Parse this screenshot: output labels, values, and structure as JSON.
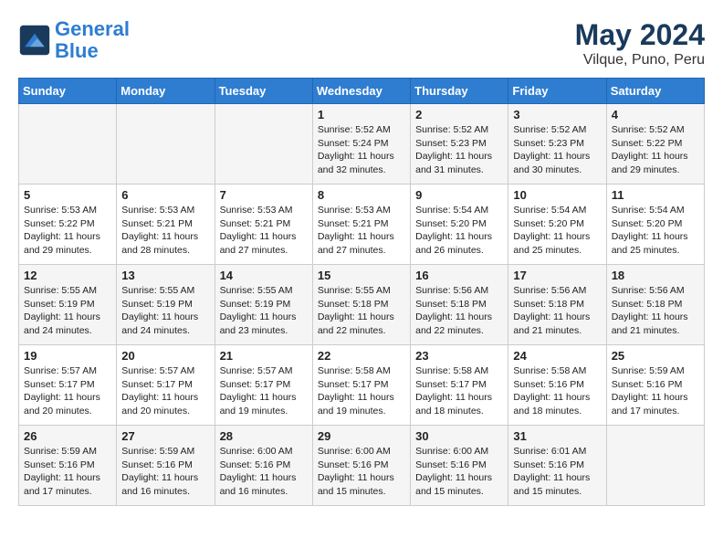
{
  "header": {
    "logo_line1": "General",
    "logo_line2": "Blue",
    "title": "May 2024",
    "subtitle": "Vilque, Puno, Peru"
  },
  "days_of_week": [
    "Sunday",
    "Monday",
    "Tuesday",
    "Wednesday",
    "Thursday",
    "Friday",
    "Saturday"
  ],
  "weeks": [
    [
      {
        "num": "",
        "info": ""
      },
      {
        "num": "",
        "info": ""
      },
      {
        "num": "",
        "info": ""
      },
      {
        "num": "1",
        "info": "Sunrise: 5:52 AM\nSunset: 5:24 PM\nDaylight: 11 hours\nand 32 minutes."
      },
      {
        "num": "2",
        "info": "Sunrise: 5:52 AM\nSunset: 5:23 PM\nDaylight: 11 hours\nand 31 minutes."
      },
      {
        "num": "3",
        "info": "Sunrise: 5:52 AM\nSunset: 5:23 PM\nDaylight: 11 hours\nand 30 minutes."
      },
      {
        "num": "4",
        "info": "Sunrise: 5:52 AM\nSunset: 5:22 PM\nDaylight: 11 hours\nand 29 minutes."
      }
    ],
    [
      {
        "num": "5",
        "info": "Sunrise: 5:53 AM\nSunset: 5:22 PM\nDaylight: 11 hours\nand 29 minutes."
      },
      {
        "num": "6",
        "info": "Sunrise: 5:53 AM\nSunset: 5:21 PM\nDaylight: 11 hours\nand 28 minutes."
      },
      {
        "num": "7",
        "info": "Sunrise: 5:53 AM\nSunset: 5:21 PM\nDaylight: 11 hours\nand 27 minutes."
      },
      {
        "num": "8",
        "info": "Sunrise: 5:53 AM\nSunset: 5:21 PM\nDaylight: 11 hours\nand 27 minutes."
      },
      {
        "num": "9",
        "info": "Sunrise: 5:54 AM\nSunset: 5:20 PM\nDaylight: 11 hours\nand 26 minutes."
      },
      {
        "num": "10",
        "info": "Sunrise: 5:54 AM\nSunset: 5:20 PM\nDaylight: 11 hours\nand 25 minutes."
      },
      {
        "num": "11",
        "info": "Sunrise: 5:54 AM\nSunset: 5:20 PM\nDaylight: 11 hours\nand 25 minutes."
      }
    ],
    [
      {
        "num": "12",
        "info": "Sunrise: 5:55 AM\nSunset: 5:19 PM\nDaylight: 11 hours\nand 24 minutes."
      },
      {
        "num": "13",
        "info": "Sunrise: 5:55 AM\nSunset: 5:19 PM\nDaylight: 11 hours\nand 24 minutes."
      },
      {
        "num": "14",
        "info": "Sunrise: 5:55 AM\nSunset: 5:19 PM\nDaylight: 11 hours\nand 23 minutes."
      },
      {
        "num": "15",
        "info": "Sunrise: 5:55 AM\nSunset: 5:18 PM\nDaylight: 11 hours\nand 22 minutes."
      },
      {
        "num": "16",
        "info": "Sunrise: 5:56 AM\nSunset: 5:18 PM\nDaylight: 11 hours\nand 22 minutes."
      },
      {
        "num": "17",
        "info": "Sunrise: 5:56 AM\nSunset: 5:18 PM\nDaylight: 11 hours\nand 21 minutes."
      },
      {
        "num": "18",
        "info": "Sunrise: 5:56 AM\nSunset: 5:18 PM\nDaylight: 11 hours\nand 21 minutes."
      }
    ],
    [
      {
        "num": "19",
        "info": "Sunrise: 5:57 AM\nSunset: 5:17 PM\nDaylight: 11 hours\nand 20 minutes."
      },
      {
        "num": "20",
        "info": "Sunrise: 5:57 AM\nSunset: 5:17 PM\nDaylight: 11 hours\nand 20 minutes."
      },
      {
        "num": "21",
        "info": "Sunrise: 5:57 AM\nSunset: 5:17 PM\nDaylight: 11 hours\nand 19 minutes."
      },
      {
        "num": "22",
        "info": "Sunrise: 5:58 AM\nSunset: 5:17 PM\nDaylight: 11 hours\nand 19 minutes."
      },
      {
        "num": "23",
        "info": "Sunrise: 5:58 AM\nSunset: 5:17 PM\nDaylight: 11 hours\nand 18 minutes."
      },
      {
        "num": "24",
        "info": "Sunrise: 5:58 AM\nSunset: 5:16 PM\nDaylight: 11 hours\nand 18 minutes."
      },
      {
        "num": "25",
        "info": "Sunrise: 5:59 AM\nSunset: 5:16 PM\nDaylight: 11 hours\nand 17 minutes."
      }
    ],
    [
      {
        "num": "26",
        "info": "Sunrise: 5:59 AM\nSunset: 5:16 PM\nDaylight: 11 hours\nand 17 minutes."
      },
      {
        "num": "27",
        "info": "Sunrise: 5:59 AM\nSunset: 5:16 PM\nDaylight: 11 hours\nand 16 minutes."
      },
      {
        "num": "28",
        "info": "Sunrise: 6:00 AM\nSunset: 5:16 PM\nDaylight: 11 hours\nand 16 minutes."
      },
      {
        "num": "29",
        "info": "Sunrise: 6:00 AM\nSunset: 5:16 PM\nDaylight: 11 hours\nand 15 minutes."
      },
      {
        "num": "30",
        "info": "Sunrise: 6:00 AM\nSunset: 5:16 PM\nDaylight: 11 hours\nand 15 minutes."
      },
      {
        "num": "31",
        "info": "Sunrise: 6:01 AM\nSunset: 5:16 PM\nDaylight: 11 hours\nand 15 minutes."
      },
      {
        "num": "",
        "info": ""
      }
    ]
  ]
}
